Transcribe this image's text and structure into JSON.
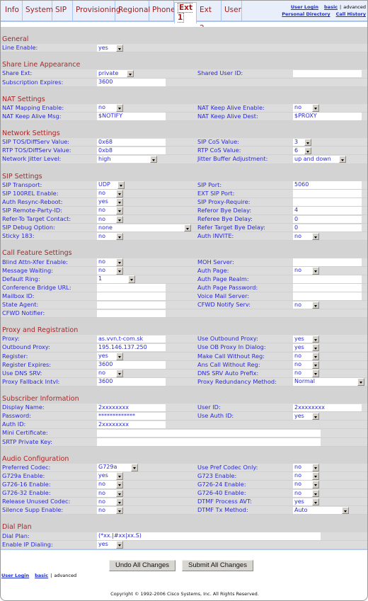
{
  "tabs": [
    {
      "label": "Info"
    },
    {
      "label": "System"
    },
    {
      "label": "SIP"
    },
    {
      "label": "Provisioning"
    },
    {
      "label": "Regional"
    },
    {
      "label": "Phone"
    },
    {
      "label": "Ext 1",
      "active": true
    },
    {
      "label": "Ext 2"
    },
    {
      "label": "User"
    }
  ],
  "top_links": {
    "user_login": "User Login",
    "basic": "basic",
    "sep": "|",
    "advanced": "advanced",
    "personal_directory": "Personal Directory",
    "call_history": "Call History"
  },
  "sections": [
    {
      "title": "General",
      "rows": [
        [
          {
            "label": "Line Enable:",
            "type": "select",
            "value": "yes"
          },
          null
        ]
      ]
    },
    {
      "title": "Share Line Appearance",
      "rows": [
        [
          {
            "label": "Share Ext:",
            "type": "select",
            "value": "private"
          },
          {
            "label": "Shared User ID:",
            "type": "text",
            "value": ""
          }
        ],
        [
          {
            "label": "Subscription Expires:",
            "type": "text",
            "value": "3600"
          },
          null
        ]
      ]
    },
    {
      "title": "NAT Settings",
      "rows": [
        [
          {
            "label": "NAT Mapping Enable:",
            "type": "select",
            "value": "no"
          },
          {
            "label": "NAT Keep Alive Enable:",
            "type": "select",
            "value": "no"
          }
        ],
        [
          {
            "label": "NAT Keep Alive Msg:",
            "type": "text",
            "value": "$NOTIFY"
          },
          {
            "label": "NAT Keep Alive Dest:",
            "type": "text",
            "value": "$PROXY"
          }
        ]
      ]
    },
    {
      "title": "Network Settings",
      "rows": [
        [
          {
            "label": "SIP TOS/DiffServ Value:",
            "type": "text",
            "value": "0x68"
          },
          {
            "label": "SIP CoS Value:",
            "type": "select",
            "value": "3"
          }
        ],
        [
          {
            "label": "RTP TOS/DiffServ Value:",
            "type": "text",
            "value": "0xb8"
          },
          {
            "label": "RTP CoS Value:",
            "type": "select",
            "value": "6"
          }
        ],
        [
          {
            "label": "Network Jitter Level:",
            "type": "select",
            "value": "high"
          },
          {
            "label": "Jitter Buffer Adjustment:",
            "type": "select",
            "value": "up and down"
          }
        ]
      ]
    },
    {
      "title": "SIP Settings",
      "rows": [
        [
          {
            "label": "SIP Transport:",
            "type": "select",
            "value": "UDP"
          },
          {
            "label": "SIP Port:",
            "type": "text",
            "value": "5060"
          }
        ],
        [
          {
            "label": "SIP 100REL Enable:",
            "type": "select",
            "value": "no"
          },
          {
            "label": "EXT SIP Port:",
            "type": "text",
            "value": ""
          }
        ],
        [
          {
            "label": "Auth Resync-Reboot:",
            "type": "select",
            "value": "yes"
          },
          {
            "label": "SIP Proxy-Require:",
            "type": "text",
            "value": ""
          }
        ],
        [
          {
            "label": "SIP Remote-Party-ID:",
            "type": "select",
            "value": "no"
          },
          {
            "label": "Referor Bye Delay:",
            "type": "text",
            "value": "4"
          }
        ],
        [
          {
            "label": "Refer-To Target Contact:",
            "type": "select",
            "value": "no"
          },
          {
            "label": "Referee Bye Delay:",
            "type": "text",
            "value": "0"
          }
        ],
        [
          {
            "label": "SIP Debug Option:",
            "type": "select",
            "value": "none"
          },
          {
            "label": "Refer Target Bye Delay:",
            "type": "text",
            "value": "0"
          }
        ],
        [
          {
            "label": "Sticky 183:",
            "type": "select",
            "value": "no"
          },
          {
            "label": "Auth INVITE:",
            "type": "select",
            "value": "no"
          }
        ]
      ]
    },
    {
      "title": "Call Feature Settings",
      "rows": [
        [
          {
            "label": "Blind Attn-Xfer Enable:",
            "type": "select",
            "value": "no"
          },
          {
            "label": "MOH Server:",
            "type": "text",
            "value": ""
          }
        ],
        [
          {
            "label": "Message Waiting:",
            "type": "select",
            "value": "no"
          },
          {
            "label": "Auth Page:",
            "type": "select",
            "value": "no"
          }
        ],
        [
          {
            "label": "Default Ring:",
            "type": "select",
            "value": "1"
          },
          {
            "label": "Auth Page Realm:",
            "type": "text",
            "value": ""
          }
        ],
        [
          {
            "label": "Conference Bridge URL:",
            "type": "text",
            "value": ""
          },
          {
            "label": "Auth Page Password:",
            "type": "text",
            "value": ""
          }
        ],
        [
          {
            "label": "Mailbox ID:",
            "type": "text",
            "value": ""
          },
          {
            "label": "Voice Mail Server:",
            "type": "text",
            "value": ""
          }
        ],
        [
          {
            "label": "State Agent:",
            "type": "text",
            "value": ""
          },
          {
            "label": "CFWD Notify Serv:",
            "type": "select",
            "value": "no"
          }
        ],
        [
          {
            "label": "CFWD Notifier:",
            "type": "text",
            "value": ""
          },
          null
        ]
      ]
    },
    {
      "title": "Proxy and Registration",
      "rows": [
        [
          {
            "label": "Proxy:",
            "type": "text",
            "value": "as.vvn.t-com.sk"
          },
          {
            "label": "Use Outbound Proxy:",
            "type": "select",
            "value": "yes"
          }
        ],
        [
          {
            "label": "Outbound Proxy:",
            "type": "text",
            "value": "195.146.137.250"
          },
          {
            "label": "Use OB Proxy In Dialog:",
            "type": "select",
            "value": "yes"
          }
        ],
        [
          {
            "label": "Register:",
            "type": "select",
            "value": "yes"
          },
          {
            "label": "Make Call Without Reg:",
            "type": "select",
            "value": "no"
          }
        ],
        [
          {
            "label": "Register Expires:",
            "type": "text",
            "value": "3600"
          },
          {
            "label": "Ans Call Without Reg:",
            "type": "select",
            "value": "no"
          }
        ],
        [
          {
            "label": "Use DNS SRV:",
            "type": "select",
            "value": "no"
          },
          {
            "label": "DNS SRV Auto Prefix:",
            "type": "select",
            "value": "no"
          }
        ],
        [
          {
            "label": "Proxy Fallback Intvl:",
            "type": "text",
            "value": "3600"
          },
          {
            "label": "Proxy Redundancy Method:",
            "type": "select",
            "value": "Normal"
          }
        ]
      ]
    },
    {
      "title": "Subscriber Information",
      "rows": [
        [
          {
            "label": "Display Name:",
            "type": "text",
            "value": "2xxxxxxxx"
          },
          {
            "label": "User ID:",
            "type": "text",
            "value": "2xxxxxxxx"
          }
        ],
        [
          {
            "label": "Password:",
            "type": "text",
            "value": "*************"
          },
          {
            "label": "Use Auth ID:",
            "type": "select",
            "value": "yes"
          }
        ],
        [
          {
            "label": "Auth ID:",
            "type": "text",
            "value": "2xxxxxxxx"
          },
          null
        ],
        [
          {
            "label": "Mini Certificate:",
            "type": "wide",
            "value": ""
          },
          null
        ],
        [
          {
            "label": "SRTP Private Key:",
            "type": "wide",
            "value": ""
          },
          null
        ]
      ]
    },
    {
      "title": "Audio Configuration",
      "rows": [
        [
          {
            "label": "Preferred Codec:",
            "type": "select",
            "value": "G729a"
          },
          {
            "label": "Use Pref Codec Only:",
            "type": "select",
            "value": "no"
          }
        ],
        [
          {
            "label": "G729a Enable:",
            "type": "select",
            "value": "yes"
          },
          {
            "label": "G723 Enable:",
            "type": "select",
            "value": "no"
          }
        ],
        [
          {
            "label": "G726-16 Enable:",
            "type": "select",
            "value": "no"
          },
          {
            "label": "G726-24 Enable:",
            "type": "select",
            "value": "no"
          }
        ],
        [
          {
            "label": "G726-32 Enable:",
            "type": "select",
            "value": "no"
          },
          {
            "label": "G726-40 Enable:",
            "type": "select",
            "value": "no"
          }
        ],
        [
          {
            "label": "Release Unused Codec:",
            "type": "select",
            "value": "no"
          },
          {
            "label": "DTMF Process AVT:",
            "type": "select",
            "value": "yes"
          }
        ],
        [
          {
            "label": "Silence Supp Enable:",
            "type": "select",
            "value": "no"
          },
          {
            "label": "DTMF Tx Method:",
            "type": "select",
            "value": "Auto"
          }
        ]
      ]
    },
    {
      "title": "Dial Plan",
      "rows": [
        [
          {
            "label": "Dial Plan:",
            "type": "wide",
            "value": "(*xx.|#xx|xx.S)"
          },
          null
        ],
        [
          {
            "label": "Enable IP Dialing:",
            "type": "select",
            "value": "yes"
          },
          null
        ]
      ]
    }
  ],
  "buttons": {
    "undo": "Undo All Changes",
    "submit": "Submit All Changes"
  },
  "bottom_links": {
    "user_login": "User Login",
    "basic": "basic",
    "sep": "|",
    "advanced": "advanced"
  },
  "copyright": "Copyright © 1992-2006 Cisco Systems, Inc. All Rights Reserved."
}
